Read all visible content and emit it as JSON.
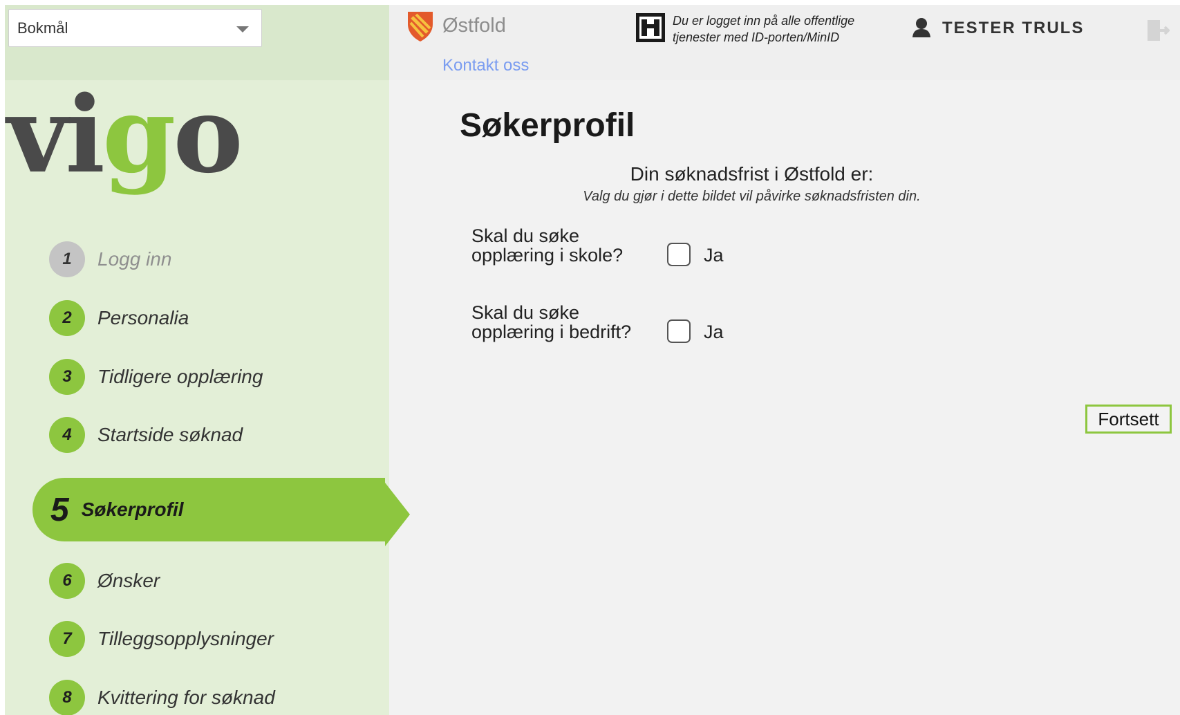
{
  "language_select": {
    "value": "Bokmål"
  },
  "logo": {
    "part1": "vi",
    "part2": "g",
    "part3": "o"
  },
  "header": {
    "county": "Østfold",
    "contact_link": "Kontakt oss",
    "login_info": "Du er logget inn på alle offentlige tjenester med ID-porten/MinID",
    "username": "TESTER TRULS"
  },
  "steps": [
    {
      "number": "1",
      "label": "Logg inn",
      "state": "done"
    },
    {
      "number": "2",
      "label": "Personalia",
      "state": "todo"
    },
    {
      "number": "3",
      "label": "Tidligere opplæring",
      "state": "todo"
    },
    {
      "number": "4",
      "label": "Startside søknad",
      "state": "todo"
    },
    {
      "number": "5",
      "label": "Søkerprofil",
      "state": "active"
    },
    {
      "number": "6",
      "label": "Ønsker",
      "state": "todo"
    },
    {
      "number": "7",
      "label": "Tilleggsopplysninger",
      "state": "todo"
    },
    {
      "number": "8",
      "label": "Kvittering for søknad",
      "state": "todo"
    }
  ],
  "main": {
    "title": "Søkerprofil",
    "deadline_text": "Din søknadsfrist i Østfold er:",
    "deadline_note": "Valg du gjør i dette bildet vil påvirke søknadsfristen din.",
    "questions": [
      {
        "line1": "Skal du søke",
        "line2": "opplæring i skole?",
        "option": "Ja",
        "checked": false
      },
      {
        "line1": "Skal du søke",
        "line2": "opplæring i bedrift?",
        "option": "Ja",
        "checked": false
      }
    ],
    "continue_label": "Fortsett"
  },
  "colors": {
    "accent_green": "#8dc63f",
    "sidebar_bg": "#e3efd7",
    "link_blue": "#7a9cf0"
  },
  "icons": {
    "county_shield": "shield-icon",
    "id_porten": "id-porten-icon",
    "user": "user-icon",
    "logout": "logout-icon",
    "dropdown": "chevron-down-icon"
  }
}
